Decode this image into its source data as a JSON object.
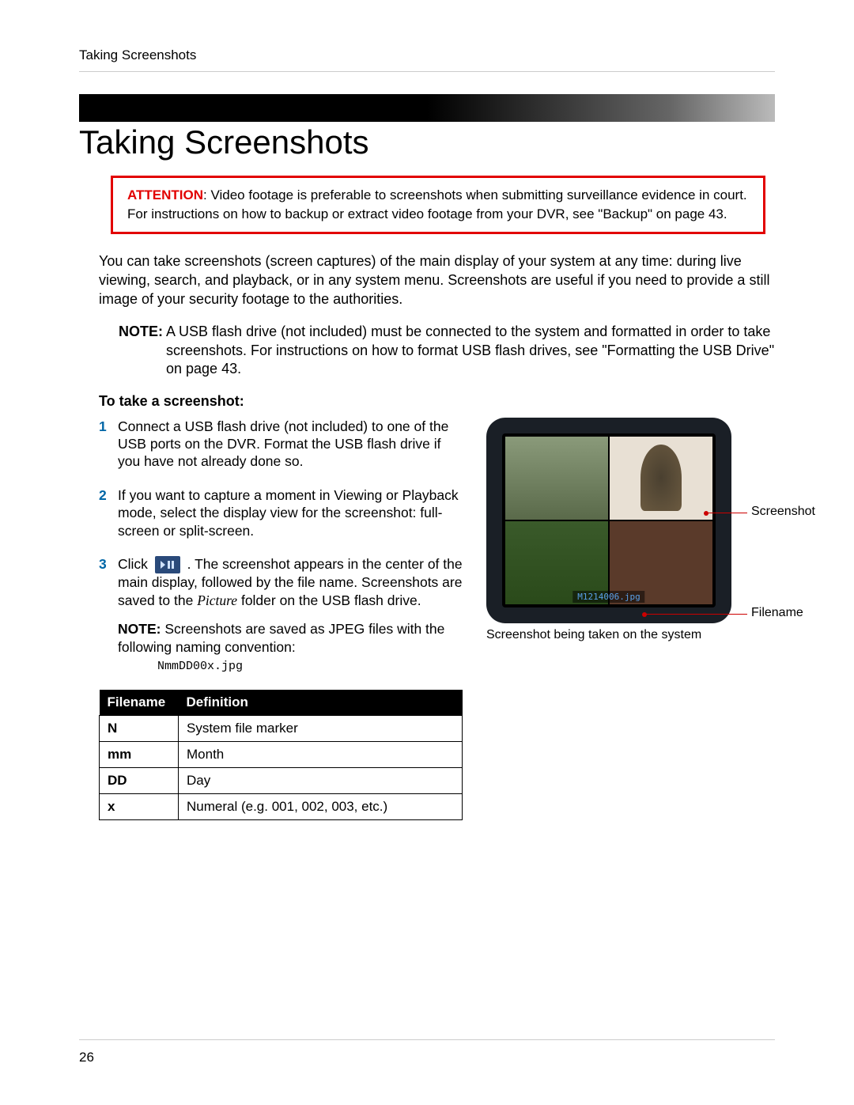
{
  "header": "Taking Screenshots",
  "title": "Taking Screenshots",
  "attention": {
    "label": "ATTENTION",
    "text": ": Video footage is preferable to screenshots when submitting surveillance evidence in court. For instructions on how to backup or extract video footage from your DVR, see \"Backup\" on page 43."
  },
  "intro": "You can take screenshots (screen captures) of the main display of your system at any time: during live viewing, search, and playback, or in any system menu. Screenshots are useful if you need to provide a still image of your security footage to the authorities.",
  "note1": {
    "label": "NOTE:",
    "text": "A USB flash drive (not included) must be connected to the system and formatted in order to take screenshots. For instructions on how to format USB flash drives, see \"Formatting the USB Drive\" on page 43."
  },
  "subhead": "To take a screenshot:",
  "steps": [
    {
      "num": "1",
      "text": "Connect a USB flash drive (not included) to one of the USB ports on the DVR. Format the USB flash drive if you have not already done so."
    },
    {
      "num": "2",
      "text": "If you want to capture a moment in Viewing or Playback mode, select the display view for the screenshot: full-screen or split-screen."
    },
    {
      "num": "3",
      "pre": "Click ",
      "post": " . The screenshot appears in the center of the main display, followed by the file name. Screenshots are saved to the ",
      "italic": "Picture",
      "post2": " folder on the USB flash drive.",
      "inner_note_label": "NOTE:",
      "inner_note_text": " Screenshots are saved as JPEG files with the following naming convention:",
      "mono": "NmmDD00x.jpg"
    }
  ],
  "figure": {
    "filename_overlay": "M1214006.jpg",
    "label_screenshot": "Screenshot",
    "label_filename": "Filename",
    "caption": "Screenshot being taken on the system"
  },
  "table": {
    "headers": [
      "Filename",
      "Definition"
    ],
    "rows": [
      [
        "N",
        "System file marker"
      ],
      [
        "mm",
        "Month"
      ],
      [
        "DD",
        "Day"
      ],
      [
        "x",
        "Numeral (e.g. 001, 002, 003, etc.)"
      ]
    ]
  },
  "page_number": "26"
}
